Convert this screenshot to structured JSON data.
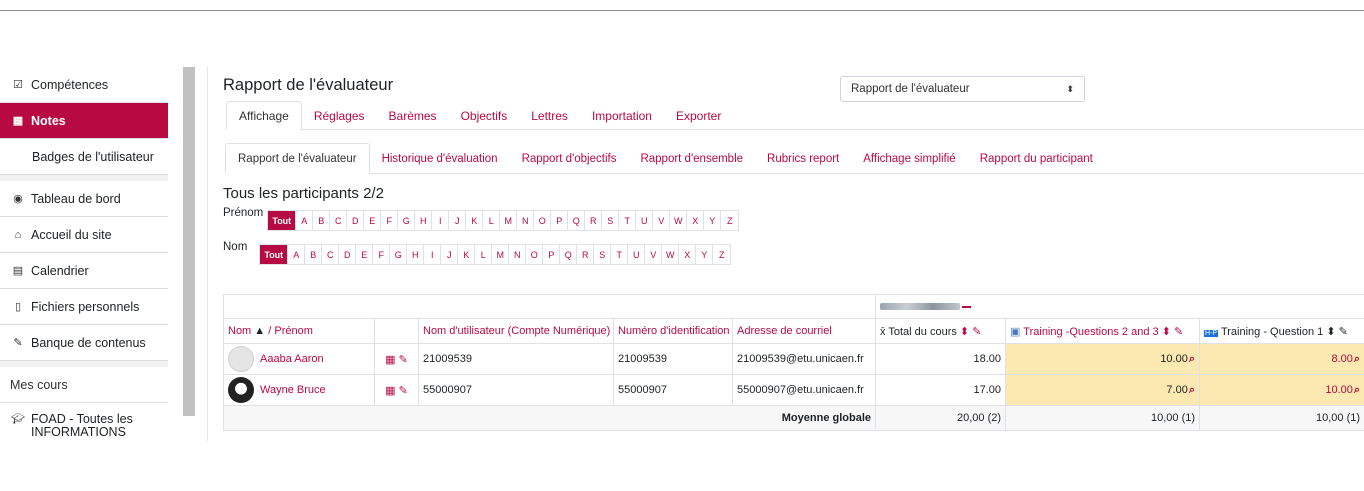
{
  "sidebar": {
    "items": [
      {
        "icon": "☑",
        "label": "Compétences"
      },
      {
        "icon": "▦",
        "label": "Notes"
      },
      {
        "label": "Badges de l'utilisateur"
      },
      {
        "icon": "◉",
        "label": "Tableau de bord"
      },
      {
        "icon": "⌂",
        "label": "Accueil du site"
      },
      {
        "icon": "▤",
        "label": "Calendrier"
      },
      {
        "icon": "▯",
        "label": "Fichiers personnels"
      },
      {
        "icon": "✎",
        "label": "Banque de contenus"
      }
    ],
    "mes_cours": "Mes cours",
    "course_label": "FOAD - Toutes les INFORMATIONS"
  },
  "page": {
    "title": "Rapport de l'évaluateur",
    "select_value": "Rapport de l'évaluateur",
    "tabs1": [
      "Affichage",
      "Réglages",
      "Barèmes",
      "Objectifs",
      "Lettres",
      "Importation",
      "Exporter"
    ],
    "tabs2": [
      "Rapport de l'évaluateur",
      "Historique d'évaluation",
      "Rapport d'objectifs",
      "Rapport d'ensemble",
      "Rubrics report",
      "Affichage simplifié",
      "Rapport du participant"
    ],
    "participants_title": "Tous les participants 2/2",
    "prenom_label": "Prénom",
    "nom_label": "Nom",
    "all_label": "Tout",
    "letters": [
      "A",
      "B",
      "C",
      "D",
      "E",
      "F",
      "G",
      "H",
      "I",
      "J",
      "K",
      "L",
      "M",
      "N",
      "O",
      "P",
      "Q",
      "R",
      "S",
      "T",
      "U",
      "V",
      "W",
      "X",
      "Y",
      "Z"
    ]
  },
  "grid": {
    "headers": {
      "nom": "Nom",
      "prenom": "/ Prénom",
      "username": "Nom d'utilisateur (Compte Numérique)",
      "idnumber": "Numéro d'identification",
      "email": "Adresse de courriel",
      "total": "Total du cours",
      "col1": "Training -Questions 2 and 3",
      "col2": "Training - Question 1"
    },
    "rows": [
      {
        "name": "Aaaba Aaron",
        "username": "21009539",
        "idnumber": "21009539",
        "email": "21009539@etu.unicaen.fr",
        "total": "18.00",
        "g1": "10.00",
        "g2": "8.00"
      },
      {
        "name": "Wayne Bruce",
        "username": "55000907",
        "idnumber": "55000907",
        "email": "55000907@etu.unicaen.fr",
        "total": "17.00",
        "g1": "7.00",
        "g2": "10.00"
      }
    ],
    "avg_label": "Moyenne globale",
    "avg": {
      "total": "20,00 (2)",
      "g1": "10,00 (1)",
      "g2": "10,00 (1)"
    }
  }
}
